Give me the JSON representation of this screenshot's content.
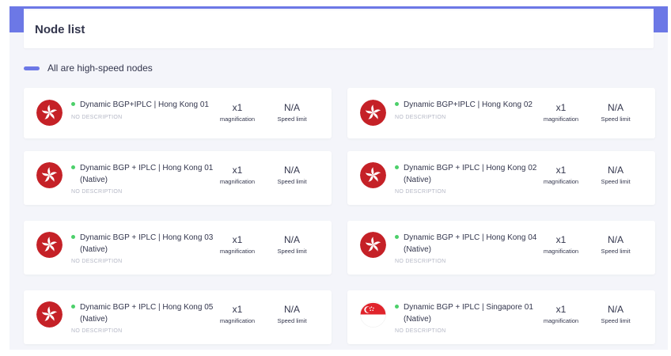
{
  "header": {
    "title": "Node list"
  },
  "section": {
    "label": "All are high-speed nodes"
  },
  "labels": {
    "magnification": "magnification",
    "speed_limit": "Speed limit"
  },
  "colors": {
    "accent": "#6c78e6",
    "online": "#4cd06a",
    "hk_flag": "#c52127",
    "sg_flag": "#e0242c"
  },
  "nodes": [
    {
      "name": "Dynamic BGP+IPLC | Hong Kong 01",
      "description": "NO DESCRIPTION",
      "multiplier": "x1",
      "speed_limit": "N/A",
      "flag_icon": "hong-kong-flag-icon",
      "status": "online"
    },
    {
      "name": "Dynamic BGP+IPLC | Hong Kong 02",
      "description": "NO DESCRIPTION",
      "multiplier": "x1",
      "speed_limit": "N/A",
      "flag_icon": "hong-kong-flag-icon",
      "status": "online"
    },
    {
      "name": "Dynamic BGP + IPLC | Hong Kong 01 (Native)",
      "description": "NO DESCRIPTION",
      "multiplier": "x1",
      "speed_limit": "N/A",
      "flag_icon": "hong-kong-flag-icon",
      "status": "online"
    },
    {
      "name": "Dynamic BGP + IPLC | Hong Kong 02 (Native)",
      "description": "NO DESCRIPTION",
      "multiplier": "x1",
      "speed_limit": "N/A",
      "flag_icon": "hong-kong-flag-icon",
      "status": "online"
    },
    {
      "name": "Dynamic BGP + IPLC | Hong Kong 03 (Native)",
      "description": "NO DESCRIPTION",
      "multiplier": "x1",
      "speed_limit": "N/A",
      "flag_icon": "hong-kong-flag-icon",
      "status": "online"
    },
    {
      "name": "Dynamic BGP + IPLC | Hong Kong 04 (Native)",
      "description": "NO DESCRIPTION",
      "multiplier": "x1",
      "speed_limit": "N/A",
      "flag_icon": "hong-kong-flag-icon",
      "status": "online"
    },
    {
      "name": "Dynamic BGP + IPLC | Hong Kong 05 (Native)",
      "description": "NO DESCRIPTION",
      "multiplier": "x1",
      "speed_limit": "N/A",
      "flag_icon": "hong-kong-flag-icon",
      "status": "online"
    },
    {
      "name": "Dynamic BGP + IPLC | Singapore 01 (Native)",
      "description": "NO DESCRIPTION",
      "multiplier": "x1",
      "speed_limit": "N/A",
      "flag_icon": "singapore-flag-icon",
      "status": "online"
    }
  ]
}
